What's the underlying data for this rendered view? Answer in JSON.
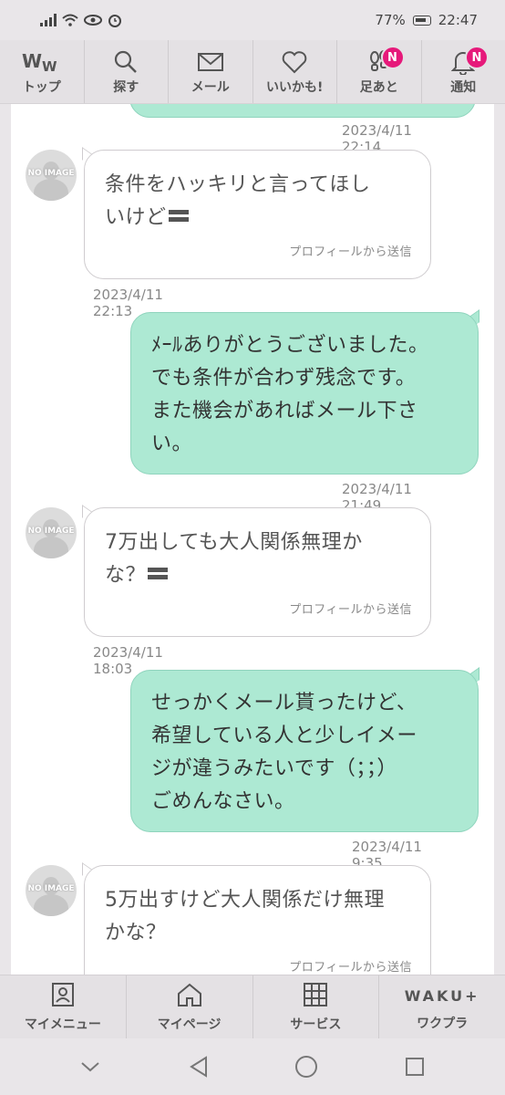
{
  "status_bar": {
    "battery": "77%",
    "time": "22:47"
  },
  "top_nav": [
    {
      "label": "トップ",
      "icon": "ww-logo-icon"
    },
    {
      "label": "探す",
      "icon": "search-icon"
    },
    {
      "label": "メール",
      "icon": "mail-icon"
    },
    {
      "label": "いいかも!",
      "icon": "heart-icon"
    },
    {
      "label": "足あと",
      "icon": "footprints-icon",
      "badge": "N"
    },
    {
      "label": "通知",
      "icon": "bell-icon",
      "badge": "N"
    }
  ],
  "messages": [
    {
      "direction": "out",
      "timestamp": "2023/4/11 22:14"
    },
    {
      "direction": "in",
      "avatar_text": "NO IMAGE",
      "lines": [
        "条件をハッキリと言ってほし",
        "いけど"
      ],
      "source": "プロフィールから送信",
      "timestamp": "2023/4/11 22:13"
    },
    {
      "direction": "out",
      "lines": [
        "ﾒｰﾙありがとうございました。",
        "でも条件が合わず残念です。",
        "また機会があればメール下さ",
        "い。"
      ],
      "timestamp": "2023/4/11 21:49"
    },
    {
      "direction": "in",
      "avatar_text": "NO IMAGE",
      "lines": [
        "7万出しても大人関係無理か",
        "な？"
      ],
      "source": "プロフィールから送信",
      "timestamp": "2023/4/11 18:03"
    },
    {
      "direction": "out",
      "lines": [
        "せっかくメール貰ったけど、",
        "希望している人と少しイメー",
        "ジが違うみたいです（；；）",
        "ごめんなさい。"
      ],
      "timestamp": "2023/4/11 9:35"
    },
    {
      "direction": "in",
      "avatar_text": "NO IMAGE",
      "lines": [
        "5万出すけど大人関係だけ無理",
        "かな？"
      ],
      "source": "プロフィールから送信"
    }
  ],
  "bottom_menu": [
    {
      "label": "マイメニュー",
      "icon": "profile-card-icon"
    },
    {
      "label": "マイページ",
      "icon": "home-icon"
    },
    {
      "label": "サービス",
      "icon": "grid-icon"
    },
    {
      "label": "ワクプラ",
      "logo": "WAKU+"
    }
  ]
}
